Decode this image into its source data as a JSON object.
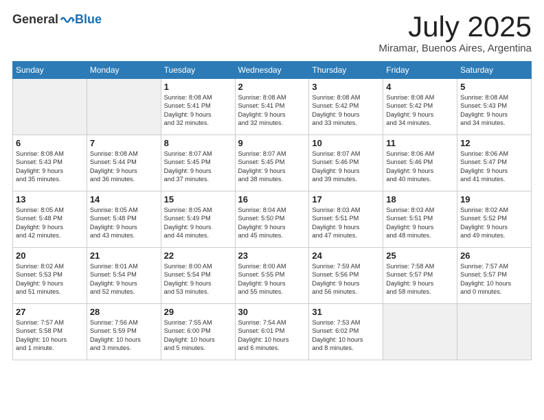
{
  "header": {
    "logo_general": "General",
    "logo_blue": "Blue",
    "month_title": "July 2025",
    "location": "Miramar, Buenos Aires, Argentina"
  },
  "days_of_week": [
    "Sunday",
    "Monday",
    "Tuesday",
    "Wednesday",
    "Thursday",
    "Friday",
    "Saturday"
  ],
  "weeks": [
    [
      {
        "day": "",
        "info": ""
      },
      {
        "day": "",
        "info": ""
      },
      {
        "day": "1",
        "info": "Sunrise: 8:08 AM\nSunset: 5:41 PM\nDaylight: 9 hours\nand 32 minutes."
      },
      {
        "day": "2",
        "info": "Sunrise: 8:08 AM\nSunset: 5:41 PM\nDaylight: 9 hours\nand 32 minutes."
      },
      {
        "day": "3",
        "info": "Sunrise: 8:08 AM\nSunset: 5:42 PM\nDaylight: 9 hours\nand 33 minutes."
      },
      {
        "day": "4",
        "info": "Sunrise: 8:08 AM\nSunset: 5:42 PM\nDaylight: 9 hours\nand 34 minutes."
      },
      {
        "day": "5",
        "info": "Sunrise: 8:08 AM\nSunset: 5:43 PM\nDaylight: 9 hours\nand 34 minutes."
      }
    ],
    [
      {
        "day": "6",
        "info": "Sunrise: 8:08 AM\nSunset: 5:43 PM\nDaylight: 9 hours\nand 35 minutes."
      },
      {
        "day": "7",
        "info": "Sunrise: 8:08 AM\nSunset: 5:44 PM\nDaylight: 9 hours\nand 36 minutes."
      },
      {
        "day": "8",
        "info": "Sunrise: 8:07 AM\nSunset: 5:45 PM\nDaylight: 9 hours\nand 37 minutes."
      },
      {
        "day": "9",
        "info": "Sunrise: 8:07 AM\nSunset: 5:45 PM\nDaylight: 9 hours\nand 38 minutes."
      },
      {
        "day": "10",
        "info": "Sunrise: 8:07 AM\nSunset: 5:46 PM\nDaylight: 9 hours\nand 39 minutes."
      },
      {
        "day": "11",
        "info": "Sunrise: 8:06 AM\nSunset: 5:46 PM\nDaylight: 9 hours\nand 40 minutes."
      },
      {
        "day": "12",
        "info": "Sunrise: 8:06 AM\nSunset: 5:47 PM\nDaylight: 9 hours\nand 41 minutes."
      }
    ],
    [
      {
        "day": "13",
        "info": "Sunrise: 8:05 AM\nSunset: 5:48 PM\nDaylight: 9 hours\nand 42 minutes."
      },
      {
        "day": "14",
        "info": "Sunrise: 8:05 AM\nSunset: 5:48 PM\nDaylight: 9 hours\nand 43 minutes."
      },
      {
        "day": "15",
        "info": "Sunrise: 8:05 AM\nSunset: 5:49 PM\nDaylight: 9 hours\nand 44 minutes."
      },
      {
        "day": "16",
        "info": "Sunrise: 8:04 AM\nSunset: 5:50 PM\nDaylight: 9 hours\nand 45 minutes."
      },
      {
        "day": "17",
        "info": "Sunrise: 8:03 AM\nSunset: 5:51 PM\nDaylight: 9 hours\nand 47 minutes."
      },
      {
        "day": "18",
        "info": "Sunrise: 8:03 AM\nSunset: 5:51 PM\nDaylight: 9 hours\nand 48 minutes."
      },
      {
        "day": "19",
        "info": "Sunrise: 8:02 AM\nSunset: 5:52 PM\nDaylight: 9 hours\nand 49 minutes."
      }
    ],
    [
      {
        "day": "20",
        "info": "Sunrise: 8:02 AM\nSunset: 5:53 PM\nDaylight: 9 hours\nand 51 minutes."
      },
      {
        "day": "21",
        "info": "Sunrise: 8:01 AM\nSunset: 5:54 PM\nDaylight: 9 hours\nand 52 minutes."
      },
      {
        "day": "22",
        "info": "Sunrise: 8:00 AM\nSunset: 5:54 PM\nDaylight: 9 hours\nand 53 minutes."
      },
      {
        "day": "23",
        "info": "Sunrise: 8:00 AM\nSunset: 5:55 PM\nDaylight: 9 hours\nand 55 minutes."
      },
      {
        "day": "24",
        "info": "Sunrise: 7:59 AM\nSunset: 5:56 PM\nDaylight: 9 hours\nand 56 minutes."
      },
      {
        "day": "25",
        "info": "Sunrise: 7:58 AM\nSunset: 5:57 PM\nDaylight: 9 hours\nand 58 minutes."
      },
      {
        "day": "26",
        "info": "Sunrise: 7:57 AM\nSunset: 5:57 PM\nDaylight: 10 hours\nand 0 minutes."
      }
    ],
    [
      {
        "day": "27",
        "info": "Sunrise: 7:57 AM\nSunset: 5:58 PM\nDaylight: 10 hours\nand 1 minute."
      },
      {
        "day": "28",
        "info": "Sunrise: 7:56 AM\nSunset: 5:59 PM\nDaylight: 10 hours\nand 3 minutes."
      },
      {
        "day": "29",
        "info": "Sunrise: 7:55 AM\nSunset: 6:00 PM\nDaylight: 10 hours\nand 5 minutes."
      },
      {
        "day": "30",
        "info": "Sunrise: 7:54 AM\nSunset: 6:01 PM\nDaylight: 10 hours\nand 6 minutes."
      },
      {
        "day": "31",
        "info": "Sunrise: 7:53 AM\nSunset: 6:02 PM\nDaylight: 10 hours\nand 8 minutes."
      },
      {
        "day": "",
        "info": ""
      },
      {
        "day": "",
        "info": ""
      }
    ]
  ]
}
